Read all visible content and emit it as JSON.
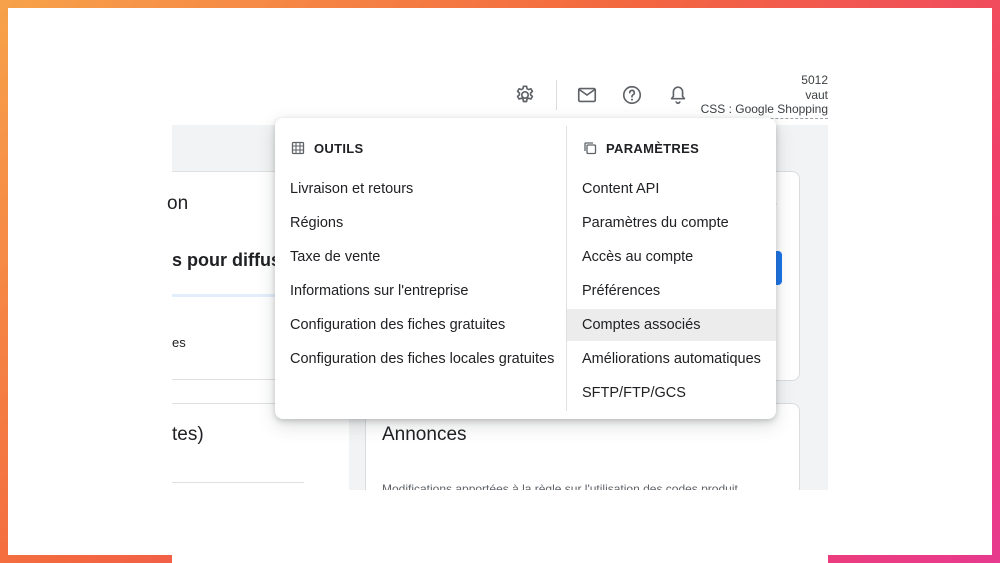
{
  "account": {
    "id": "5012",
    "name": "vaut",
    "subtitle": "CSS : Google Shopping"
  },
  "topbar": {
    "icons": [
      "gear-icon",
      "mail-icon",
      "help-icon",
      "bell-icon"
    ]
  },
  "background": {
    "left_text_1": "on",
    "left_text_2": "s pour diffus",
    "left_text_3": "es",
    "left_text_4": "tes)",
    "card_title": "Annonces",
    "card_sub": "Modifications apportées à la règle sur l'utilisation des codes produit"
  },
  "menu": {
    "tools": {
      "header": "OUTILS",
      "items": [
        "Livraison et retours",
        "Régions",
        "Taxe de vente",
        "Informations sur l'entreprise",
        "Configuration des fiches gratuites",
        "Configuration des fiches locales gratuites"
      ]
    },
    "settings": {
      "header": "PARAMÈTRES",
      "items": [
        "Content API",
        "Paramètres du compte",
        "Accès au compte",
        "Préférences",
        "Comptes associés",
        "Améliorations automatiques",
        "SFTP/FTP/GCS"
      ],
      "highlighted_item": "Comptes associés"
    }
  },
  "colors": {
    "accent": "#1a73e8",
    "highlight": "#ececec",
    "frame_start": "#f7a24a",
    "frame_end": "#e83a8e"
  }
}
